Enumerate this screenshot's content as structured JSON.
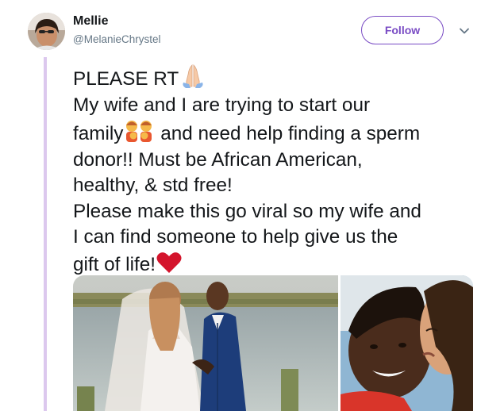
{
  "author": {
    "name": "Mellie",
    "handle": "@MelanieChrystel"
  },
  "follow_label": "Follow",
  "icons": {
    "avatar": "profile-photo",
    "caret": "chevron-down-icon",
    "pray": "folded-hands-emoji",
    "family": "family-emoji",
    "heart": "red-heart-emoji"
  },
  "colors": {
    "accent": "#794bc4",
    "thread_line": "#dcc8ee",
    "handle": "#657786",
    "text": "#14171a"
  },
  "tweet": {
    "line1": "PLEASE RT",
    "line2": "My wife and I are trying to start our",
    "line3a": "family",
    "line3b": " and need help finding a sperm",
    "line4": "donor!! Must be African American,",
    "line5": "healthy, & std free!",
    "line6": "Please make this go viral so my wife and",
    "line7": "I can find someone to help give us the",
    "line8": "gift of life!"
  },
  "media": [
    {
      "kind": "photo",
      "subject": "wedding-photo"
    },
    {
      "kind": "photo",
      "subject": "selfie-photo"
    }
  ]
}
